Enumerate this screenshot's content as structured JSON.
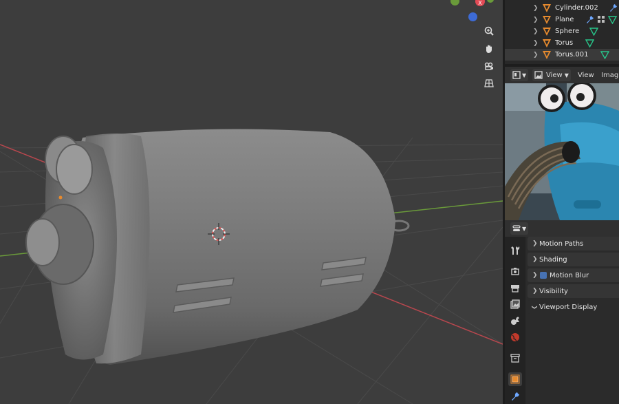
{
  "outliner": {
    "rows": [
      {
        "name": "Cylinder.002",
        "selected": false
      },
      {
        "name": "Plane",
        "selected": false
      },
      {
        "name": "Sphere",
        "selected": false
      },
      {
        "name": "Torus",
        "selected": false
      },
      {
        "name": "Torus.001",
        "selected": true
      }
    ]
  },
  "image_editor": {
    "view_menu": "View",
    "view_label": "View",
    "image_label": "Imag"
  },
  "properties": {
    "panels": [
      {
        "label": "Motion Paths",
        "expanded": false
      },
      {
        "label": "Shading",
        "expanded": false
      },
      {
        "label": "Motion Blur",
        "expanded": false
      },
      {
        "label": "Visibility",
        "expanded": false
      },
      {
        "label": "Viewport Display",
        "expanded": true
      }
    ],
    "tabs": [
      "tool-icon",
      "render-icon",
      "output-icon",
      "view-layer-icon",
      "scene-icon",
      "world-icon",
      "collection-icon",
      "object-icon",
      "modifier-icon"
    ]
  },
  "viewport": {
    "nav_icons": [
      "zoom-icon",
      "pan-hand-icon",
      "camera-icon",
      "grid-icon"
    ],
    "gizmo_x_label": "X"
  },
  "colors": {
    "accent_orange": "#e68a2e",
    "axis_red": "#b8474e",
    "axis_green": "#6a9a3a",
    "modifier_blue": "#6ea8ff",
    "mesh_green": "#28c58a"
  }
}
